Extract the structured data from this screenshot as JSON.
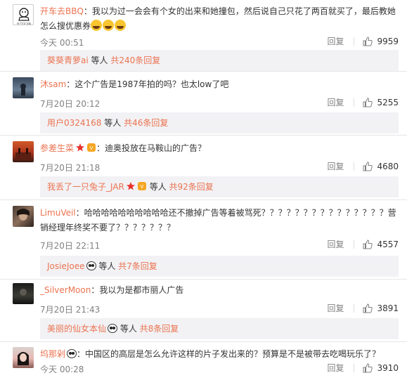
{
  "ui": {
    "reply_label": "回复",
    "accent_color": "#eb7350",
    "like_icon": "thumbs-up-icon"
  },
  "comments": [
    {
      "username": "开车去BBQ",
      "text": "：我以为过一会会有个女的出来和她撞包，然后说自己只花了两百就买了，最后教她怎么搜优惠券",
      "time": "今天 00:51",
      "likes": "9959",
      "avatar_label": "没了文字 清除",
      "sub": {
        "user": "葵葵青萝ai",
        "mid": " 等人 ",
        "total": "共240条回复"
      }
    },
    {
      "username": "沐sam",
      "text": "：这个广告是1987年拍的吗？也太low了吧",
      "time": "7月20日 20:12",
      "likes": "5255",
      "sub": {
        "user": "用户0324168",
        "mid": " 等人 ",
        "total": "共46条回复"
      }
    },
    {
      "username": "参差生菜",
      "text": "：迪奥投放在马鞍山的广告？",
      "time": "7月20日 21:18",
      "likes": "4680",
      "sub": {
        "user": "我丢了一只兔子_JAR",
        "mid": " 等人 ",
        "total": "共92条回复"
      }
    },
    {
      "username": "LimuVeil",
      "text": "：哈哈哈哈哈哈哈哈哈哈还不撤掉广告等着被骂死？？？？？？？？？？？？？？？营销经理年终奖不要了？？？？？？？",
      "time": "7月20日 22:11",
      "likes": "4557",
      "sub": {
        "user": "JosieJoee",
        "mid": " 等人 ",
        "total": "共7条回复"
      }
    },
    {
      "username": "_SilverMoon",
      "text": "：我以为是都市丽人广告",
      "time": "7月20日 21:43",
      "likes": "3891",
      "sub": {
        "user": "美丽的仙女本仙",
        "mid": " 等人 ",
        "total": "共8条回复"
      }
    },
    {
      "username": "坞那剁",
      "text": "：中国区的高层是怎么允许这样的片子发出来的？预算是不是被带去吃喝玩乐了？",
      "time": "今天 00:28",
      "likes": "3910"
    }
  ]
}
